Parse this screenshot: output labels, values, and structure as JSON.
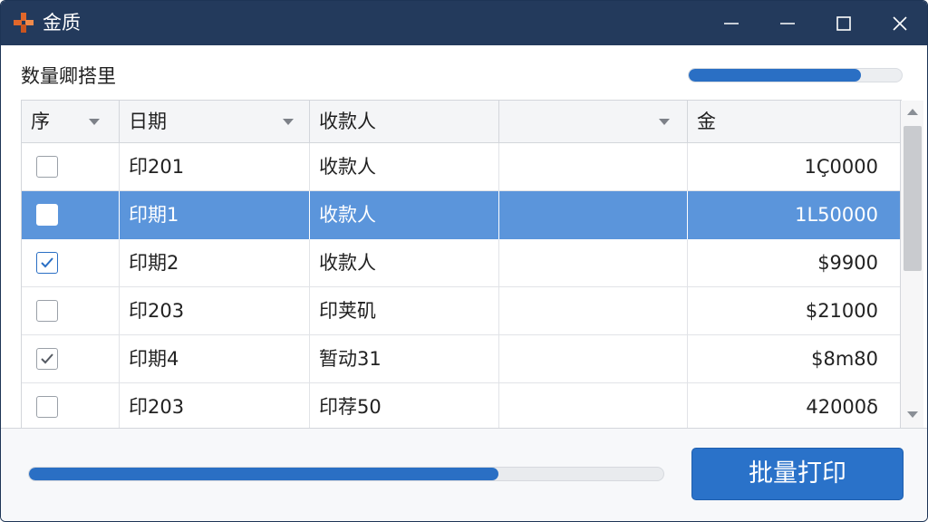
{
  "window": {
    "title": "金质",
    "app_icon": "plus-cross-logo-icon",
    "controls": [
      "minimize-icon",
      "maximize-icon",
      "close-icon"
    ]
  },
  "header": {
    "label": "数量卿搭里",
    "progress_fraction": 0.81
  },
  "table": {
    "columns": [
      {
        "label": "序",
        "sortable": true
      },
      {
        "label": "日期",
        "sortable": true
      },
      {
        "label": "收款人",
        "sortable": false
      },
      {
        "label": "",
        "sortable": true
      },
      {
        "label": "金",
        "sortable": false
      }
    ],
    "rows": [
      {
        "checked": false,
        "date": "印201",
        "payee": "收款人",
        "extra": "",
        "amount": "1Ç0000",
        "selected": false
      },
      {
        "checked": false,
        "date": "印期1",
        "payee": "收款人",
        "extra": "",
        "amount": "1Ⅼ50000",
        "selected": true
      },
      {
        "checked": true,
        "date": "印期2",
        "payee": "收款人",
        "extra": "",
        "amount": "$9900",
        "selected": false
      },
      {
        "checked": false,
        "date": "印203",
        "payee": "印荚矶",
        "extra": "",
        "amount": "$21000",
        "selected": false
      },
      {
        "checked": true,
        "date": "印期4",
        "payee": "暂动31",
        "extra": "",
        "amount": "$8m80",
        "selected": false
      },
      {
        "checked": false,
        "date": "印203",
        "payee": "印荐50",
        "extra": "",
        "amount": "42000δ",
        "selected": false
      }
    ],
    "scroll_fraction": 0.0
  },
  "footer": {
    "progress_fraction": 0.74,
    "print_button_label": "批量打印"
  },
  "colors": {
    "titlebar": "#233a5c",
    "accent": "#2a6fc4",
    "selected_row": "#5b95db",
    "logo_orange": "#e1672a"
  }
}
